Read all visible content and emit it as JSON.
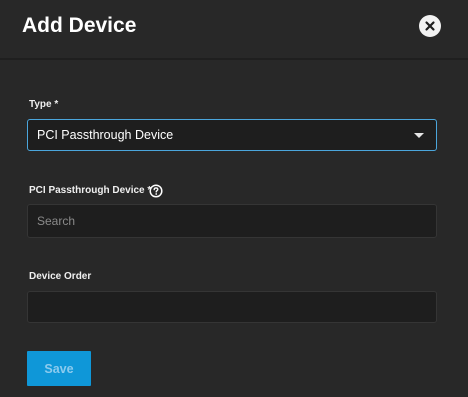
{
  "dialog": {
    "title": "Add Device",
    "close_icon": "close-circle-icon"
  },
  "form": {
    "type": {
      "label": "Type *",
      "selected_value": "PCI Passthrough Device",
      "caret_icon": "caret-down-icon"
    },
    "pci_device": {
      "label": "PCI Passthrough Device *",
      "help_icon": "help-circle-icon",
      "placeholder": "Search",
      "value": ""
    },
    "device_order": {
      "label": "Device Order",
      "value": ""
    },
    "save_label": "Save"
  },
  "colors": {
    "background": "#282828",
    "field_background": "#1e1e1e",
    "focus_border": "#4ba6dc",
    "primary_button": "#0f97d8",
    "primary_button_text_disabled": "#8ccbee"
  }
}
